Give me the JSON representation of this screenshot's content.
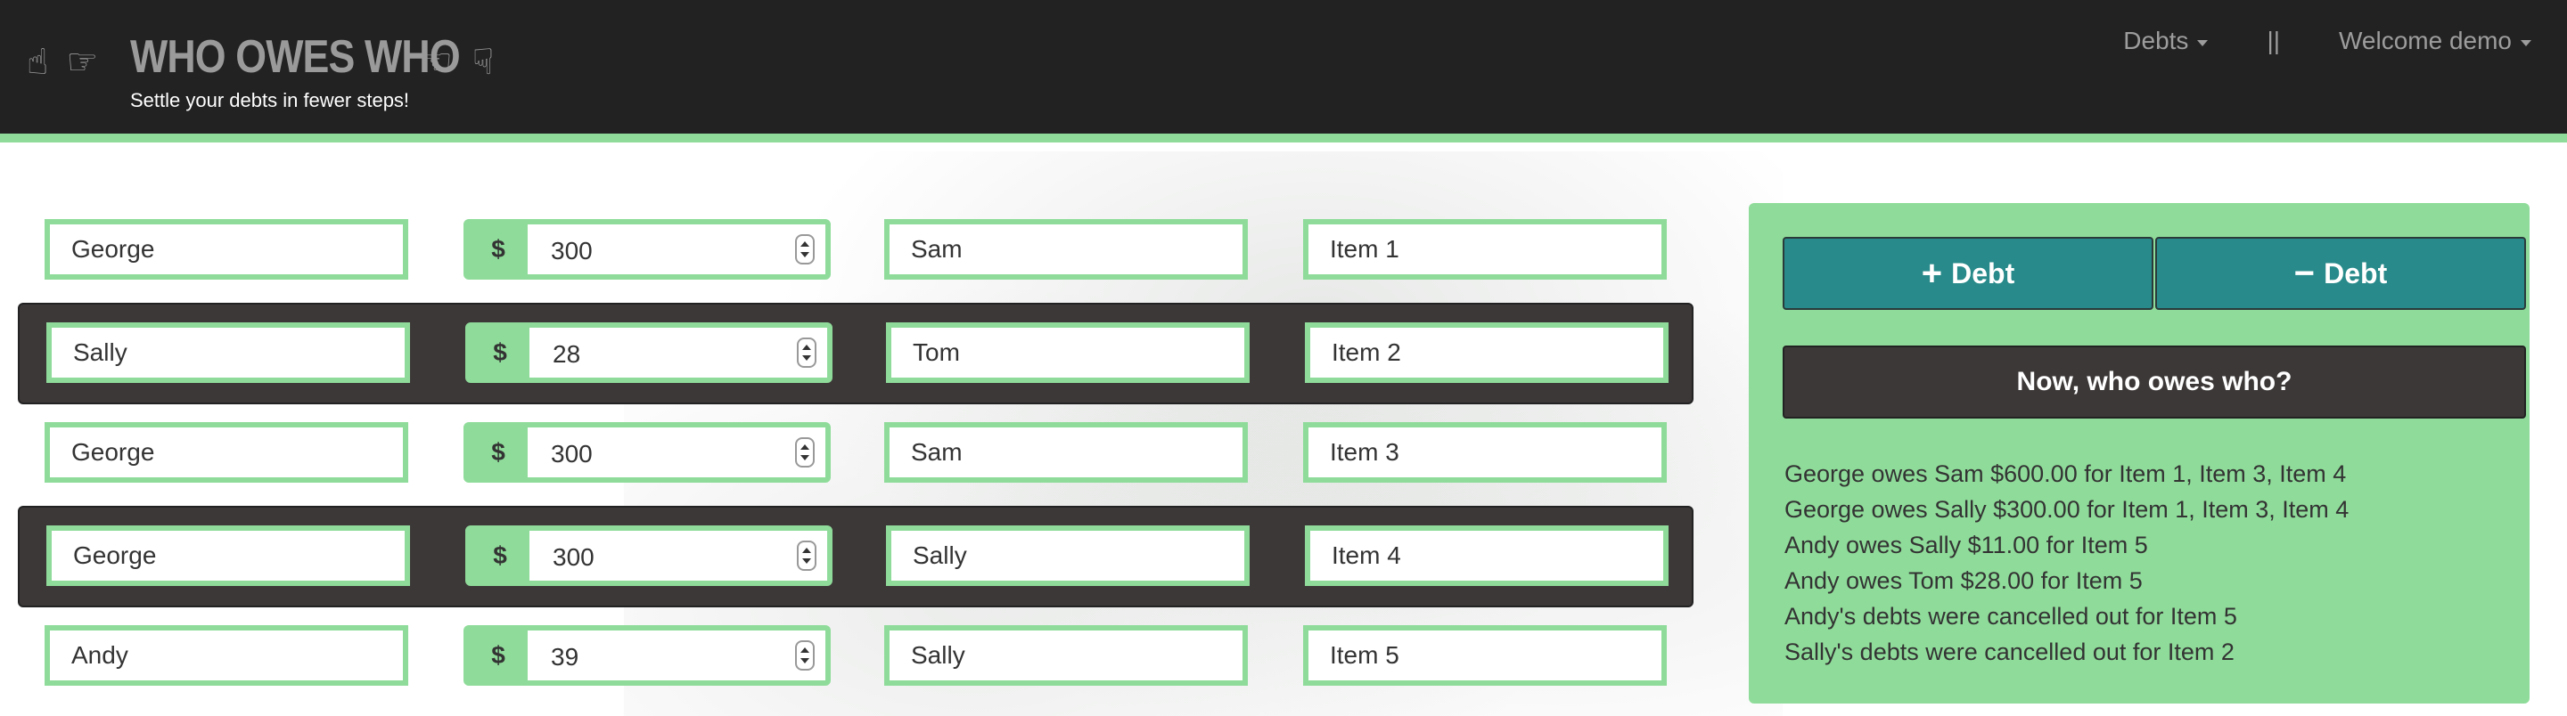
{
  "header": {
    "title": "WHO OWES WHO",
    "subtitle": "Settle your debts in fewer steps!",
    "nav": {
      "debts_label": "Debts",
      "separator": "||",
      "welcome_label": "Welcome demo"
    }
  },
  "debts": [
    {
      "from": "George",
      "currency": "$",
      "amount": "300",
      "to": "Sam",
      "item": "Item 1"
    },
    {
      "from": "Sally",
      "currency": "$",
      "amount": "28",
      "to": "Tom",
      "item": "Item 2"
    },
    {
      "from": "George",
      "currency": "$",
      "amount": "300",
      "to": "Sam",
      "item": "Item 3"
    },
    {
      "from": "George",
      "currency": "$",
      "amount": "300",
      "to": "Sally",
      "item": "Item 4"
    },
    {
      "from": "Andy",
      "currency": "$",
      "amount": "39",
      "to": "Sally",
      "item": "Item 5"
    }
  ],
  "panel": {
    "add_sign": "+",
    "add_label": "Debt",
    "remove_sign": "−",
    "remove_label": "Debt",
    "solve_label": "Now, who owes who?",
    "results": [
      "George owes Sam $600.00 for Item 1, Item 3, Item 4",
      "George owes Sally $300.00 for Item 1, Item 3, Item 4",
      "Andy owes Sally $11.00 for Item 5",
      "Andy owes Tom $28.00 for Item 5",
      "Andy's debts were cancelled out for Item 5",
      "Sally's debts were cancelled out for Item 2"
    ]
  },
  "colors": {
    "accent_green": "#8fdc9a",
    "teal_button": "#288a8a",
    "dark_row": "#3d3838",
    "navbar": "#222222"
  },
  "icons": [
    "hand-point-up-icon",
    "hand-point-right-icon",
    "hand-point-left-icon",
    "hand-point-down-icon"
  ]
}
